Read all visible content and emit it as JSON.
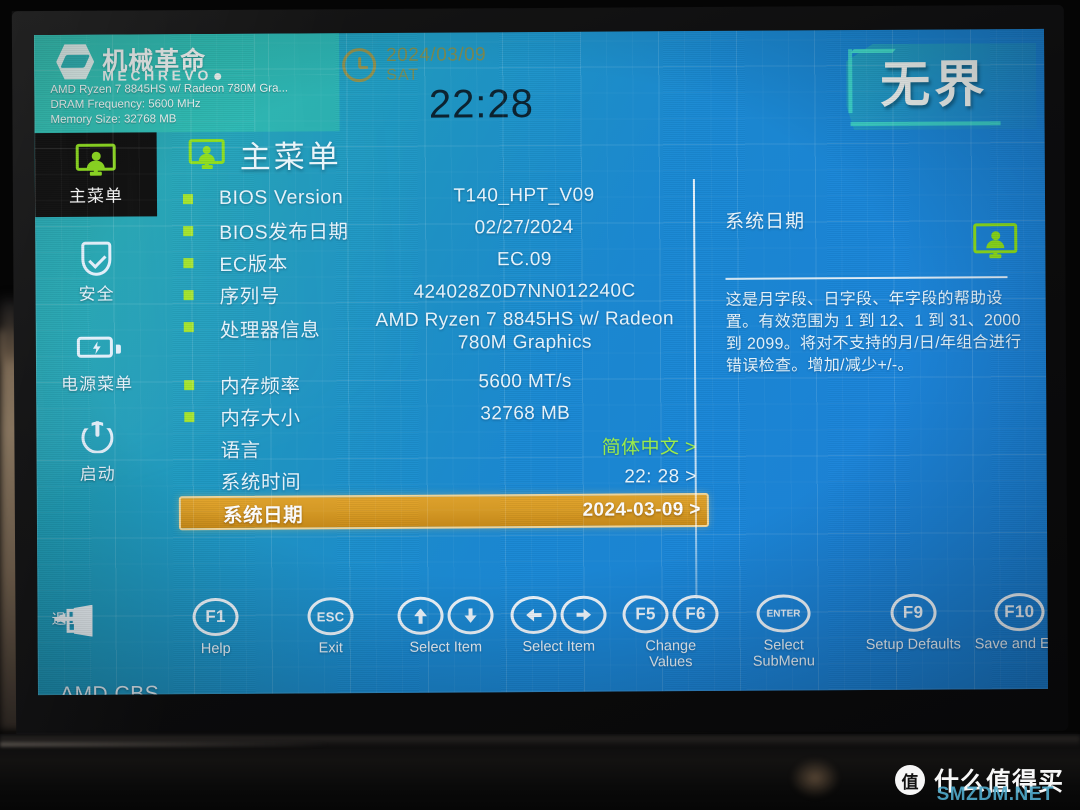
{
  "brand": {
    "name_cn": "机械革命",
    "name_en": "MECHREVO",
    "cpu_line": "AMD Ryzen 7 8845HS w/ Radeon 780M Gra...",
    "dram_line": "DRAM Frequency: 5600 MHz",
    "memory_line": "Memory Size: 32768 MB"
  },
  "clock": {
    "date": "2024/03/09",
    "weekday": "SAT",
    "time": "22:28"
  },
  "product_logo": "无界",
  "sidebar": {
    "items": [
      {
        "label": "主菜单",
        "icon": "monitor-icon",
        "active": true
      },
      {
        "label": "安全",
        "icon": "shield-icon",
        "active": false
      },
      {
        "label": "电源菜单",
        "icon": "battery-icon",
        "active": false
      },
      {
        "label": "启动",
        "icon": "power-icon",
        "active": false
      }
    ],
    "amd_cbs": "AMD CBS",
    "exit_label": "退出"
  },
  "page": {
    "title": "主菜单",
    "title_icon": "monitor-icon"
  },
  "settings": [
    {
      "label": "BIOS Version",
      "value": "T140_HPT_V09",
      "bullet": true,
      "selected": false,
      "align": "center"
    },
    {
      "label": "BIOS发布日期",
      "value": "02/27/2024",
      "bullet": true,
      "selected": false,
      "align": "center"
    },
    {
      "label": "EC版本",
      "value": "EC.09",
      "bullet": true,
      "selected": false,
      "align": "center"
    },
    {
      "label": "序列号",
      "value": "424028Z0D7NN012240C",
      "bullet": true,
      "selected": false,
      "align": "center"
    },
    {
      "label": "处理器信息",
      "value": "AMD Ryzen 7 8845HS w/ Radeon 780M Graphics",
      "bullet": true,
      "selected": false,
      "align": "center",
      "multiline": true
    },
    {
      "label": "内存频率",
      "value": "5600 MT/s",
      "bullet": true,
      "selected": false,
      "align": "center"
    },
    {
      "label": "内存大小",
      "value": "32768 MB",
      "bullet": true,
      "selected": false,
      "align": "center"
    },
    {
      "label": "语言",
      "value": "简体中文 >",
      "bullet": false,
      "selected": false,
      "align": "right",
      "green": true
    },
    {
      "label": "系统时间",
      "value": "22: 28 >",
      "bullet": false,
      "selected": false,
      "align": "right"
    },
    {
      "label": "系统日期",
      "value": "2024-03-09 >",
      "bullet": false,
      "selected": true,
      "align": "right"
    }
  ],
  "help": {
    "title": "系统日期",
    "icon": "monitor-icon",
    "body": "这是月字段、日字段、年字段的帮助设置。有效范围为 1 到 12、1 到 31、2000 到 2099。将对不支持的月/日/年组合进行错误检查。增加/减少+/-。"
  },
  "keybar": [
    {
      "key": "exit-door-icon",
      "cap": "",
      "label": "退出",
      "type": "icon"
    },
    {
      "key": "F1",
      "cap": "F1",
      "label": "Help",
      "type": "single"
    },
    {
      "key": "ESC",
      "cap": "ESC",
      "label": "Exit",
      "type": "single"
    },
    {
      "key": "up-down",
      "cap": "",
      "label": "Select Item",
      "type": "pair-ud"
    },
    {
      "key": "left-right",
      "cap": "",
      "label": "Select Item",
      "type": "pair-lr"
    },
    {
      "key": "F5F6",
      "cap": "F5|F6",
      "label": "Change\nValues",
      "type": "pair-key"
    },
    {
      "key": "ENTER",
      "cap": "ENTER",
      "label": "Select\nSubMenu",
      "type": "single"
    },
    {
      "key": "F9",
      "cap": "F9",
      "label": "Setup Defaults",
      "type": "single"
    },
    {
      "key": "F10",
      "cap": "F10",
      "label": "Save and Exit",
      "type": "single"
    }
  ],
  "keybar_labels": {
    "exit": "退出",
    "f1": "Help",
    "esc": "Exit",
    "updown": "Select Item",
    "leftright": "Select Item",
    "f5": "F5",
    "f6": "F6",
    "f5f6_l1": "Change",
    "f5f6_l2": "Values",
    "enter": "ENTER",
    "enter_l1": "Select",
    "enter_l2": "SubMenu",
    "f9": "F9",
    "f9_label": "Setup Defaults",
    "f10": "F10",
    "f10_label": "Save and Exit",
    "f1_cap": "F1",
    "esc_cap": "ESC"
  },
  "watermark": {
    "badge": "值",
    "text": "什么值得买",
    "site": "SMZDM.NET"
  },
  "colors": {
    "accent_green": "#a4e52a",
    "highlight_gold": "#d99c25",
    "screen_teal": "#27b0b8",
    "screen_blue": "#1a80d6",
    "brand_teal": "#2bbcb4",
    "clock_olive": "#8e8a3e"
  }
}
